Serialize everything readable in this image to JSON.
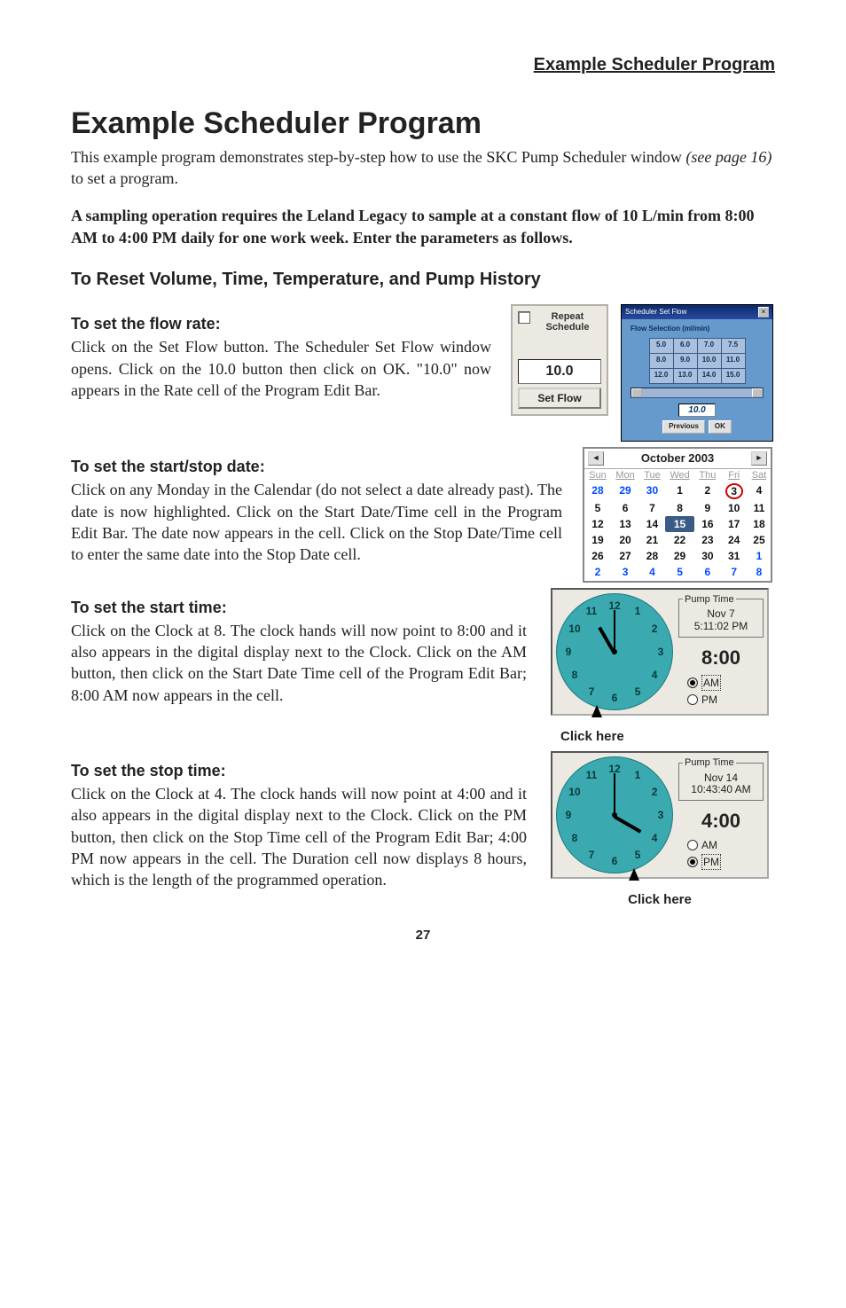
{
  "header": {
    "section_title": "Example Scheduler Program"
  },
  "title": "Example Scheduler Program",
  "intro": {
    "text_a": "This example program demonstrates step-by-step how to use the SKC Pump Scheduler window ",
    "italic": "(see page 16)",
    "text_b": " to set a program."
  },
  "bold_instr": "A sampling operation requires the Leland Legacy to sample at a constant flow of 10 L/min from 8:00 AM to 4:00 PM daily for one work week. Enter the parameters as follows.",
  "reset_heading": "To Reset Volume, Time, Temperature, and Pump History",
  "flow": {
    "heading": "To set the flow rate:",
    "body": "Click on the Set Flow button. The Scheduler Set Flow window opens. Click on the 10.0 button then click on OK. \"10.0\" now appears in the Rate cell of the Program Edit Bar."
  },
  "setflow_panel": {
    "repeat_label": "Repeat Schedule",
    "rate": "10.0",
    "button": "Set Flow"
  },
  "flowwin": {
    "title": "Scheduler Set Flow",
    "caption": "Flow Selection (ml/min)",
    "grid": [
      [
        "5.0",
        "6.0",
        "7.0",
        "7.5"
      ],
      [
        "8.0",
        "9.0",
        "10.0",
        "11.0"
      ],
      [
        "12.0",
        "13.0",
        "14.0",
        "15.0"
      ]
    ],
    "selected": "10.0",
    "previous": "Previous",
    "ok": "OK"
  },
  "date": {
    "heading": "To set the start/stop date:",
    "body": "Click on any Monday in the Calendar (do not select a date already past). The date is now highlighted. Click on the Start Date/Time cell in the Program Edit Bar. The date now appears in the cell. Click on the Stop Date/Time cell to enter the same date into the Stop Date cell."
  },
  "calendar": {
    "month": "October 2003",
    "dow": [
      "Sun",
      "Mon",
      "Tue",
      "Wed",
      "Thu",
      "Fri",
      "Sat"
    ],
    "rows": [
      [
        {
          "d": "28",
          "dim": true
        },
        {
          "d": "29",
          "dim": true
        },
        {
          "d": "30",
          "dim": true
        },
        {
          "d": "1"
        },
        {
          "d": "2"
        },
        {
          "d": "3",
          "today": true
        },
        {
          "d": "4"
        }
      ],
      [
        {
          "d": "5"
        },
        {
          "d": "6"
        },
        {
          "d": "7"
        },
        {
          "d": "8"
        },
        {
          "d": "9"
        },
        {
          "d": "10"
        },
        {
          "d": "11"
        }
      ],
      [
        {
          "d": "12"
        },
        {
          "d": "13"
        },
        {
          "d": "14"
        },
        {
          "d": "15",
          "sel": true
        },
        {
          "d": "16"
        },
        {
          "d": "17"
        },
        {
          "d": "18"
        }
      ],
      [
        {
          "d": "19"
        },
        {
          "d": "20"
        },
        {
          "d": "21"
        },
        {
          "d": "22"
        },
        {
          "d": "23"
        },
        {
          "d": "24"
        },
        {
          "d": "25"
        }
      ],
      [
        {
          "d": "26"
        },
        {
          "d": "27"
        },
        {
          "d": "28"
        },
        {
          "d": "29"
        },
        {
          "d": "30"
        },
        {
          "d": "31"
        },
        {
          "d": "1",
          "dim": true
        }
      ],
      [
        {
          "d": "2",
          "dim": true
        },
        {
          "d": "3",
          "dim": true
        },
        {
          "d": "4",
          "dim": true
        },
        {
          "d": "5",
          "dim": true
        },
        {
          "d": "6",
          "dim": true
        },
        {
          "d": "7",
          "dim": true
        },
        {
          "d": "8",
          "dim": true
        }
      ]
    ]
  },
  "start_time": {
    "heading": "To set the start time:",
    "body": "Click on the Clock  at 8. The clock hands will now point to 8:00 and it also appears in the digital display next to the Clock. Click on the AM button, then click on the Start Date Time cell of the Program Edit Bar; 8:00 AM now appears in the cell."
  },
  "clock1": {
    "legend": "Pump Time",
    "date": "Nov 7",
    "now": "5:11:02 PM",
    "big": "8:00",
    "am": "AM",
    "pm": "PM",
    "sel": "AM",
    "hour_angle": -120,
    "min_angle": -90
  },
  "stop_time": {
    "heading": "To set the stop time:",
    "body": "Click on the Clock at 4. The clock hands will now point at 4:00 and it also appears in the digital display next to the Clock. Click on the PM button, then click on the Stop Time cell of the Program Edit Bar; 4:00 PM now appears in the cell. The Duration cell now displays 8 hours, which is the length of the programmed operation."
  },
  "clock2": {
    "legend": "Pump Time",
    "date": "Nov 14",
    "now": "10:43:40 AM",
    "big": "4:00",
    "am": "AM",
    "pm": "PM",
    "sel": "PM",
    "hour_angle": 30,
    "min_angle": -90
  },
  "click_here": "Click here",
  "page_number": "27"
}
